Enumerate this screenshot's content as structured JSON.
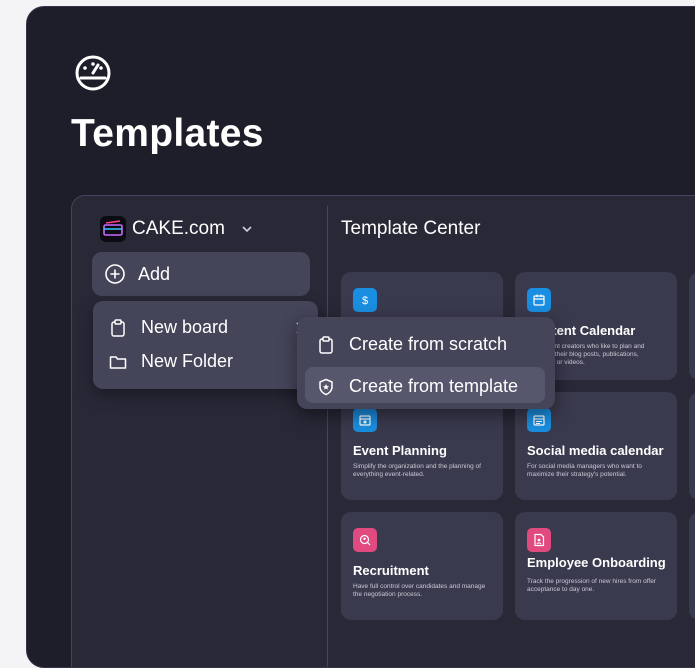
{
  "page": {
    "title": "Templates",
    "logo_icon": "dashboard-gauge-icon"
  },
  "workspace": {
    "name": "CAKE.com"
  },
  "sidebar": {
    "add_label": "Add"
  },
  "template_center": {
    "title": "Template Center",
    "cards": [
      {
        "title": "",
        "description": "",
        "icon": "dollar-icon",
        "icon_color": "#1a8ee0"
      },
      {
        "title": "Content Calendar",
        "description": "For content creators who like to plan and schedule their blog posts, publications, podcasts, or videos.",
        "icon": "calendar-icon",
        "icon_color": "#1a8ee0"
      },
      {
        "title": "Event Planning",
        "description": "Simplify the organization and the planning of everything event-related.",
        "icon": "event-calendar-icon",
        "icon_color": "#1a8ee0"
      },
      {
        "title": "Social media calendar",
        "description": "For social media managers who want to maximize their strategy's potential.",
        "icon": "social-calendar-icon",
        "icon_color": "#1a8ee0"
      },
      {
        "title": "Recruitment",
        "description": "Have full control over candidates and manage the negotiation process.",
        "icon": "search-person-icon",
        "icon_color": "#e04a7f"
      },
      {
        "title": "Employee Onboarding",
        "description": "Track the progression of new hires from offer acceptance to day one.",
        "icon": "document-person-icon",
        "icon_color": "#e04a7f"
      }
    ]
  },
  "add_menu": {
    "new_board": "New board",
    "new_folder": "New Folder"
  },
  "board_submenu": {
    "scratch": "Create from scratch",
    "template": "Create from template"
  }
}
